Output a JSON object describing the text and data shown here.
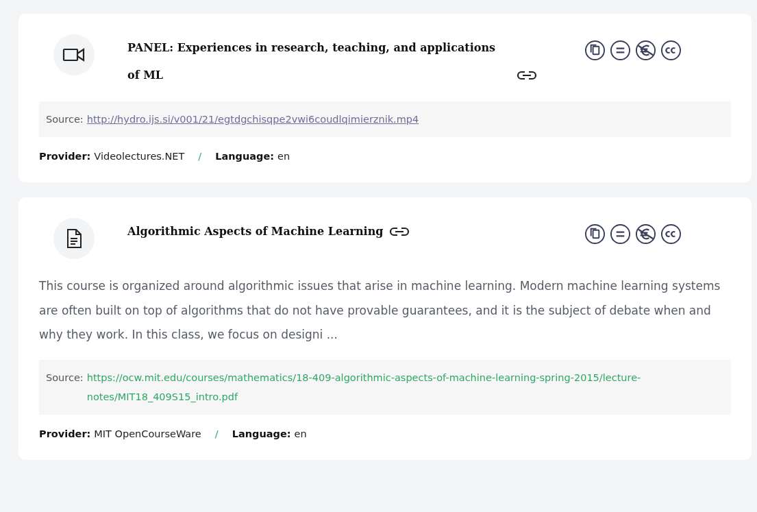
{
  "results": [
    {
      "kind": "video",
      "title": "PANEL: Experiences in research, teaching, and applications of ML",
      "separator": "/",
      "source": {
        "label": "Source:",
        "url": "http://hydro.ijs.si/v001/21/egtdgchisqpe2vwi6coudlqimierznik.mp4",
        "visited": true
      },
      "meta": [
        {
          "label": "Provider:",
          "value": "Videolectures.NET"
        },
        {
          "label": "Language:",
          "value": "en"
        }
      ]
    },
    {
      "kind": "document",
      "title": "Algorithmic Aspects of Machine Learning",
      "separator": "/",
      "description": "This course is organized around algorithmic issues that arise in machine learning. Modern machine learning systems are often built on top of algorithms that do not have provable guarantees, and it is the subject of debate when and why they work. In this class, we focus on designi ...",
      "source": {
        "label": "Source:",
        "url": "https://ocw.mit.edu/courses/mathematics/18-409-algorithmic-aspects-of-machine-learning-spring-2015/lecture-notes/MIT18_409S15_intro.pdf",
        "visited": false
      },
      "meta": [
        {
          "label": "Provider:",
          "value": "MIT OpenCourseWare"
        },
        {
          "label": "Language:",
          "value": "en"
        }
      ]
    }
  ]
}
